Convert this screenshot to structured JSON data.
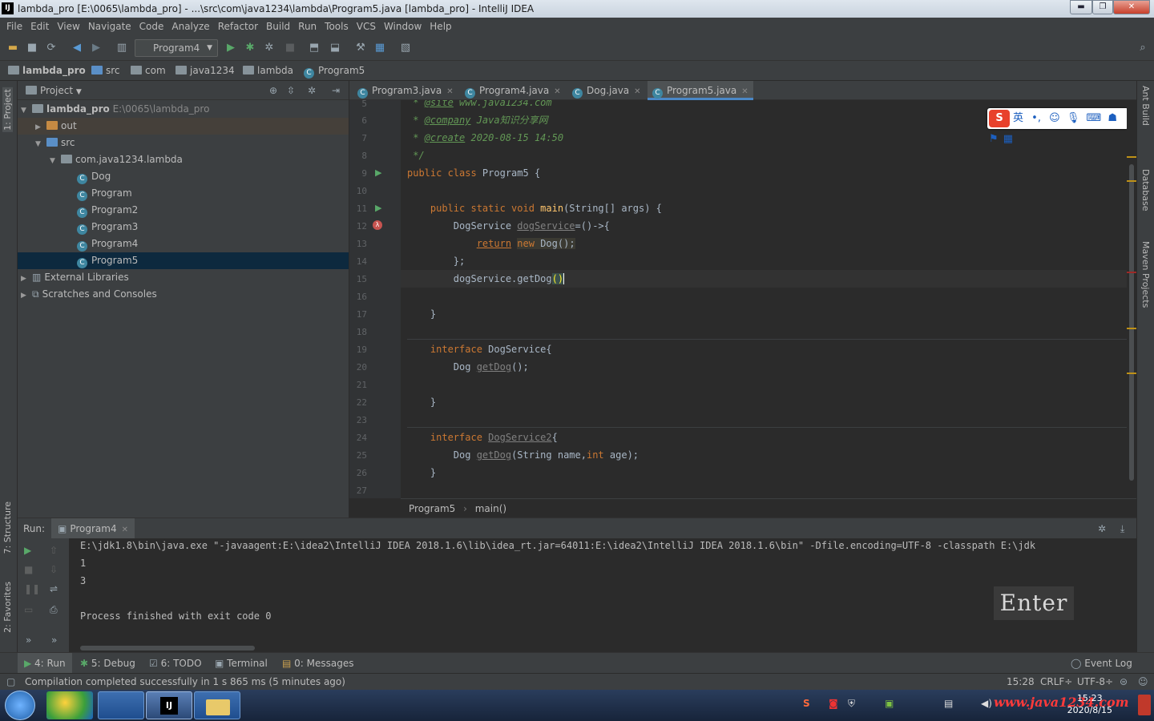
{
  "window": {
    "title": "lambda_pro [E:\\0065\\lambda_pro] - ...\\src\\com\\java1234\\lambda\\Program5.java [lambda_pro] - IntelliJ IDEA",
    "logo": "IJ",
    "minimize": "▬",
    "maximize": "❐",
    "close": "✕"
  },
  "menu": [
    "File",
    "Edit",
    "View",
    "Navigate",
    "Code",
    "Analyze",
    "Refactor",
    "Build",
    "Run",
    "Tools",
    "VCS",
    "Window",
    "Help"
  ],
  "toolbar": {
    "run_config": "Program4"
  },
  "nav": {
    "crumbs": [
      "lambda_pro",
      "src",
      "com",
      "java1234",
      "lambda",
      "Program5"
    ]
  },
  "project": {
    "header": "Project",
    "root": "lambda_pro",
    "root_path": "E:\\0065\\lambda_pro",
    "out": "out",
    "src": "src",
    "package": "com.java1234.lambda",
    "classes": [
      "Dog",
      "Program",
      "Program2",
      "Program3",
      "Program4",
      "Program5"
    ],
    "external": "External Libraries",
    "scratches": "Scratches and Consoles"
  },
  "left_strip": {
    "project": "1: Project",
    "structure": "7: Structure",
    "favorites": "2: Favorites"
  },
  "right_strip": {
    "ant": "Ant Build",
    "database": "Database",
    "maven": "Maven Projects"
  },
  "tabs": [
    "Program3.java",
    "Program4.java",
    "Dog.java",
    "Program5.java"
  ],
  "gutter_lines": [
    "5",
    "6",
    "7",
    "8",
    "9",
    "10",
    "11",
    "12",
    "13",
    "14",
    "15",
    "16",
    "17",
    "18",
    "19",
    "20",
    "21",
    "22",
    "23",
    "24",
    "25",
    "26",
    "27"
  ],
  "code": {
    "l5a": " * ",
    "l5b": "@site",
    "l5c": " www.java1234.com",
    "l6a": " * ",
    "l6b": "@company",
    "l6c": " Java知识分享网",
    "l7a": " * ",
    "l7b": "@create",
    "l7c": " 2020-08-15 14:50",
    "l8": " */",
    "l9a": "public class ",
    "l9b": "Program5 {",
    "l11a": "    public static void ",
    "l11b": "main",
    "l11c": "(String[] args) {",
    "l12a": "        DogService ",
    "l12b": "dogService",
    "l12c": "=()->{",
    "l13a": "            ",
    "l13b": "return",
    "l13c": " ",
    "l13d": "new",
    "l13e": " Dog();",
    "l14": "        };",
    "l15a": "        dogService.getDog",
    "l15b": "()",
    "l17": "    }",
    "l19a": "    interface ",
    "l19b": "DogService{",
    "l20a": "        Dog ",
    "l20b": "getDog",
    "l20c": "();",
    "l22": "    }",
    "l24a": "    interface ",
    "l24b": "DogService2",
    "l24c": "{",
    "l25a": "        Dog ",
    "l25b": "getDog",
    "l25c": "(String name,",
    "l25d": "int",
    "l25e": " age);",
    "l26": "    }"
  },
  "editor_breadcrumb": {
    "cls": "Program5",
    "method": "main()"
  },
  "run": {
    "label": "Run:",
    "tab": "Program4"
  },
  "console": {
    "cmd": "E:\\jdk1.8\\bin\\java.exe \"-javaagent:E:\\idea2\\IntelliJ IDEA 2018.1.6\\lib\\idea_rt.jar=64011:E:\\idea2\\IntelliJ IDEA 2018.1.6\\bin\" -Dfile.encoding=UTF-8 -classpath E:\\jdk",
    "out1": "1",
    "out2": "3",
    "finished": "Process finished with exit code 0"
  },
  "key_overlay": "Enter",
  "bottom_tabs": {
    "run": "4: Run",
    "debug": "5: Debug",
    "todo": "6: TODO",
    "terminal": "Terminal",
    "messages": "0: Messages",
    "eventlog": "Event Log"
  },
  "status": {
    "message": "Compilation completed successfully in 1 s 865 ms (5 minutes ago)",
    "pos": "15:28",
    "crlf": "CRLF÷",
    "enc": "UTF-8÷"
  },
  "ime": {
    "lang": "英"
  },
  "taskbar": {
    "time": "15:23",
    "date": "2020/8/15",
    "watermark": "www.java1234.com"
  }
}
